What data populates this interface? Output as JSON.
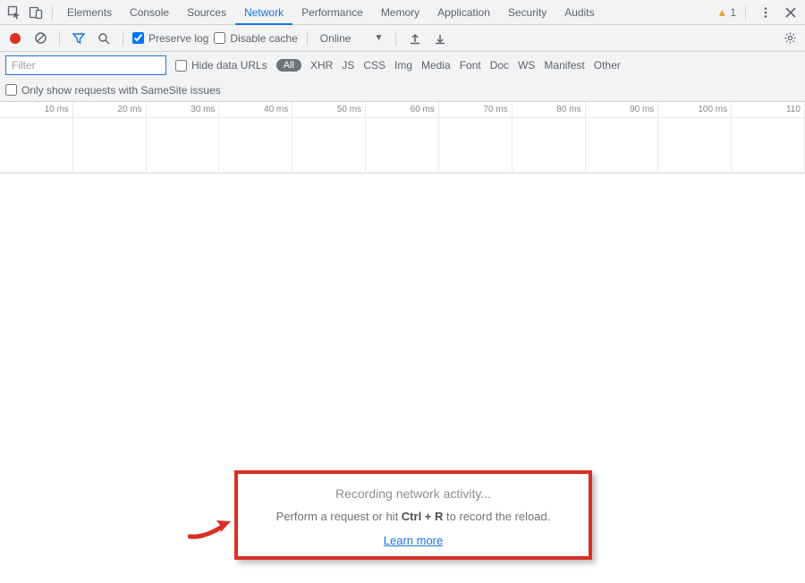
{
  "tabs": {
    "items": [
      "Elements",
      "Console",
      "Sources",
      "Network",
      "Performance",
      "Memory",
      "Application",
      "Security",
      "Audits"
    ],
    "active": "Network",
    "warning_count": "1"
  },
  "toolbar": {
    "preserve_log_label": "Preserve log",
    "disable_cache_label": "Disable cache",
    "throttling_value": "Online"
  },
  "filter": {
    "placeholder": "Filter",
    "hide_urls_label": "Hide data URLs",
    "type_all": "All",
    "types": [
      "XHR",
      "JS",
      "CSS",
      "Img",
      "Media",
      "Font",
      "Doc",
      "WS",
      "Manifest",
      "Other"
    ]
  },
  "samesite": {
    "label": "Only show requests with SameSite issues"
  },
  "timeline": {
    "ticks": [
      "10 ms",
      "20 ms",
      "30 ms",
      "40 ms",
      "50 ms",
      "60 ms",
      "70 ms",
      "80 ms",
      "90 ms",
      "100 ms",
      "110"
    ]
  },
  "empty": {
    "title": "Recording network activity...",
    "sub_prefix": "Perform a request or hit ",
    "sub_key": "Ctrl + R",
    "sub_suffix": " to record the reload.",
    "learn": "Learn more"
  }
}
